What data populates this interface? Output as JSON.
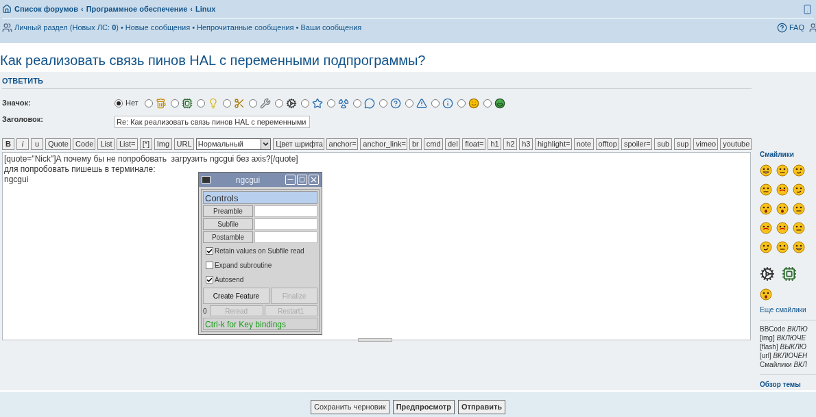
{
  "breadcrumbs": {
    "separator": "‹",
    "items": [
      "Список форумов",
      "Программное обеспечение",
      "Linux"
    ]
  },
  "nav": {
    "separator": "•",
    "links": [
      "Личный раздел (Новых ЛС: **0**)",
      "Новые сообщения",
      "Непрочитанные сообщения",
      "Ваши сообщения"
    ],
    "faq": "FAQ"
  },
  "title": "Как реализовать связь пинов HAL с переменными подпрограммы?",
  "panel_heading": "ОТВЕТИТЬ",
  "icon_field": {
    "label": "Значок:",
    "options": [
      {
        "label": "Нет",
        "selected": true
      },
      {
        "selected": false
      },
      {
        "selected": false
      },
      {
        "selected": false
      },
      {
        "selected": false
      },
      {
        "selected": false
      },
      {
        "selected": false
      },
      {
        "selected": false
      },
      {
        "selected": false
      },
      {
        "selected": false
      },
      {
        "selected": false
      },
      {
        "selected": false
      },
      {
        "selected": false
      },
      {
        "selected": false
      },
      {
        "selected": false
      }
    ]
  },
  "subject_field": {
    "label": "Заголовок:",
    "value": "Re: Как реализовать связь пинов HAL с переменными"
  },
  "toolbar": [
    {
      "label": "B",
      "kind": "bold"
    },
    {
      "label": "i",
      "kind": "italic"
    },
    {
      "label": "u",
      "kind": "underline"
    },
    {
      "label": "Quote",
      "kind": "plain"
    },
    {
      "label": "Code",
      "kind": "plain"
    },
    {
      "label": "List",
      "kind": "plain"
    },
    {
      "label": "List=",
      "kind": "plain"
    },
    {
      "label": "[*]",
      "kind": "plain"
    },
    {
      "label": "Img",
      "kind": "plain"
    },
    {
      "label": "URL",
      "kind": "plain"
    },
    {
      "label": "Нормальный",
      "kind": "select"
    },
    {
      "label": "Цвет шрифта",
      "kind": "plain"
    },
    {
      "label": "anchor=",
      "kind": "plain"
    },
    {
      "label": "anchor_link=",
      "kind": "plain"
    },
    {
      "label": "br",
      "kind": "plain"
    },
    {
      "label": "cmd",
      "kind": "plain"
    },
    {
      "label": "del",
      "kind": "plain"
    },
    {
      "label": "float=",
      "kind": "plain"
    },
    {
      "label": "h1",
      "kind": "plain"
    },
    {
      "label": "h2",
      "kind": "plain"
    },
    {
      "label": "h3",
      "kind": "plain"
    },
    {
      "label": "highlight=",
      "kind": "plain"
    },
    {
      "label": "note",
      "kind": "plain"
    },
    {
      "label": "offtop",
      "kind": "plain"
    },
    {
      "label": "spoiler=",
      "kind": "plain"
    },
    {
      "label": "sub",
      "kind": "plain"
    },
    {
      "label": "sup",
      "kind": "plain"
    },
    {
      "label": "vimeo",
      "kind": "plain"
    },
    {
      "label": "youtube",
      "kind": "plain"
    }
  ],
  "message": {
    "lines": [
      "[quote=\"Nick\"]А почему бы не попробовать  загрузить ngcgui без axis?[/quote]",
      "для попробовать пишешь в терминале:",
      "ngcgui"
    ]
  },
  "ngcgui": {
    "title": "ngcgui",
    "section": "Controls",
    "files": [
      {
        "label": "Preamble"
      },
      {
        "label": "Subfile"
      },
      {
        "label": "Postamble"
      }
    ],
    "options": [
      {
        "label": "Retain values on Subfile read",
        "checked": true
      },
      {
        "label": "Expand subroutine",
        "checked": false
      },
      {
        "label": "Autosend",
        "checked": true
      }
    ],
    "actions": [
      {
        "label": "Create Feature",
        "disabled": false
      },
      {
        "label": "Finalize",
        "disabled": true
      }
    ],
    "counter": "0",
    "secondary": [
      {
        "label": "Reread",
        "disabled": true
      },
      {
        "label": "Restart1",
        "disabled": true
      }
    ],
    "status": "Ctrl-k for Key bindings"
  },
  "sidebar": {
    "heading": "Смайлики",
    "more": "Еще смайлики",
    "status": [
      "BBCode *ВКЛЮ*",
      "[img] *ВКЛЮЧЕ*",
      "[flash] *ВЫКЛЮ*",
      "[url] *ВКЛЮЧЕН*",
      "Смайлики *ВКЛ*"
    ],
    "topic": "Обзор темы"
  },
  "buttons": [
    {
      "label": "Сохранить черновик",
      "kind": "normal"
    },
    {
      "label": "Предпросмотр",
      "kind": "primary"
    },
    {
      "label": "Отправить",
      "kind": "primary"
    }
  ]
}
